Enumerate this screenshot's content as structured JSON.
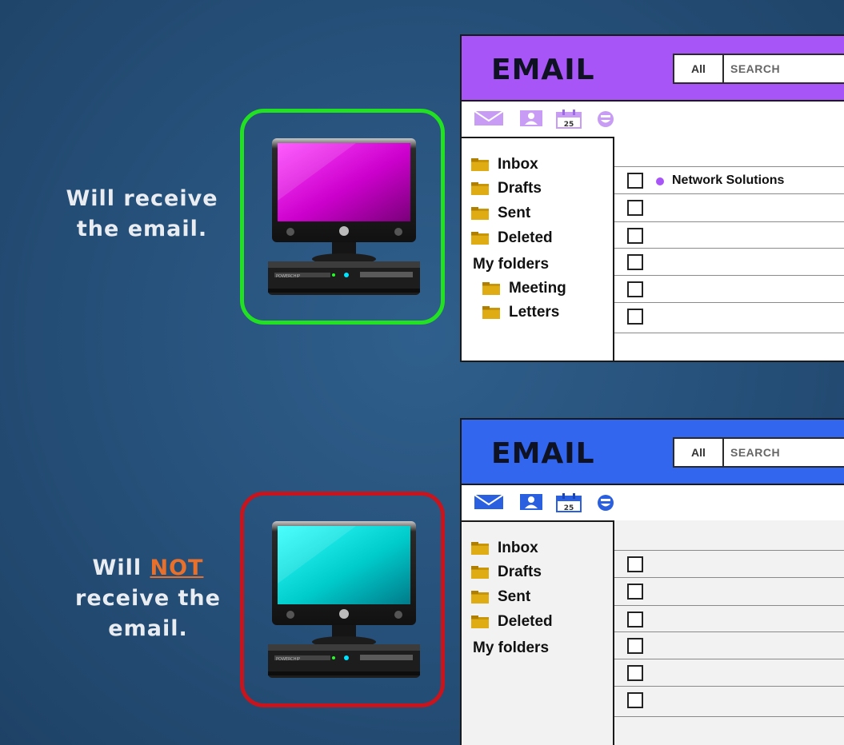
{
  "captions": {
    "top": {
      "line1": "Will receive",
      "line2": "the email."
    },
    "bottom": {
      "will": "Will",
      "not": "NOT",
      "line2": "receive the",
      "line3": "email."
    }
  },
  "colors": {
    "good_frame": "#22e022",
    "bad_frame": "#c8141c",
    "top_header": "#a855f7",
    "bottom_header": "#3366ee",
    "top_screen": "#cc00cc",
    "bottom_screen": "#00cccc",
    "not_highlight": "#e8702a"
  },
  "computers": {
    "brand": "POWERCHIP",
    "top": {
      "screen_color": "#cc00cc",
      "status": "will receive"
    },
    "bottom": {
      "screen_color": "#00cccc",
      "status": "will not receive"
    }
  },
  "email_top": {
    "title": "EMAIL",
    "search_scope": "All",
    "search_placeholder": "SEARCH",
    "toolbar_icons": [
      "mail-icon",
      "contacts-icon",
      "calendar-icon",
      "emoji-icon"
    ],
    "calendar_day": "25",
    "folders": [
      "Inbox",
      "Drafts",
      "Sent",
      "Deleted"
    ],
    "my_folders_label": "My folders",
    "sub_folders": [
      "Meeting",
      "Letters"
    ],
    "messages": [
      {
        "sender": "Network Solutions",
        "unread": true
      },
      {
        "sender": "",
        "unread": false
      },
      {
        "sender": "",
        "unread": false
      },
      {
        "sender": "",
        "unread": false
      },
      {
        "sender": "",
        "unread": false
      },
      {
        "sender": "",
        "unread": false
      }
    ]
  },
  "email_bottom": {
    "title": "EMAIL",
    "search_scope": "All",
    "search_placeholder": "SEARCH",
    "toolbar_icons": [
      "mail-icon",
      "contacts-icon",
      "calendar-icon",
      "emoji-icon"
    ],
    "calendar_day": "25",
    "folders": [
      "Inbox",
      "Drafts",
      "Sent",
      "Deleted"
    ],
    "my_folders_label": "My folders",
    "messages": [
      {
        "sender": ""
      },
      {
        "sender": ""
      },
      {
        "sender": ""
      },
      {
        "sender": ""
      },
      {
        "sender": ""
      },
      {
        "sender": ""
      }
    ]
  }
}
